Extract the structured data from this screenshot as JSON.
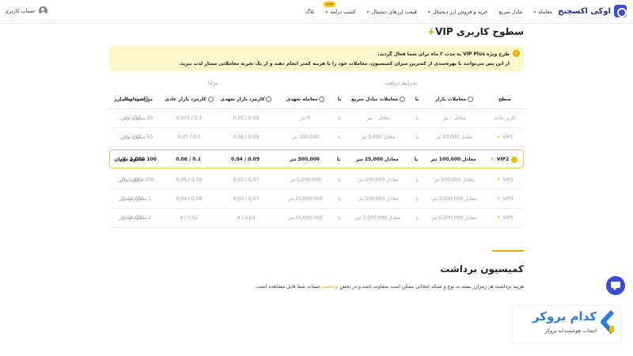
{
  "header": {
    "logo": "اوکی اکسچنج",
    "nav": [
      {
        "label": "معامله",
        "chevron": true,
        "badge": ""
      },
      {
        "label": "تبادل سریع",
        "chevron": false,
        "badge": ""
      },
      {
        "label": "خرید و فروش ارز دیجیتال",
        "chevron": true,
        "badge": ""
      },
      {
        "label": "قیمت ارزهای دیجیتال",
        "chevron": true,
        "badge": ""
      },
      {
        "label": "کسب درآمد",
        "chevron": true,
        "badge": "جدید"
      },
      {
        "label": "بلاگ",
        "chevron": false,
        "badge": ""
      }
    ],
    "account": "حساب کاربری"
  },
  "title": {
    "text": "سطوح کاربری VIP",
    "plus": "+"
  },
  "notice": {
    "line1_bold": "طرح ویژه VIP Plus به مدت ۳ ماه برای شما فعال گردید.",
    "line2": "از این پس می‌توانید با بهره‌مندی از کمترین میزان کمیسیون، معاملات خود را با هزینه کمتر انجام دهید و از یک تجربه معاملاتی ممتاز لذت ببرید."
  },
  "groups": {
    "conditions": "شرایط دریافت",
    "benefits": "مزایا"
  },
  "table": {
    "headers": [
      "سطح",
      "معاملات بازار",
      "یا",
      "معاملات تبادل سریع",
      "یا",
      "معامله تعهدی",
      "کارمزد بازار تعهدی",
      "کارمزد بازار عادی",
      "برداشت ریالی",
      "برداشت ارز"
    ],
    "rows": [
      [
        "کاربر عادی",
        "معادل ۰ تتر",
        "یا",
        "معادل ۰ تتر",
        "یا",
        "0 تتر",
        "0.09 / 0.05",
        "0.1 / 0.075",
        "20 میلیون تومان",
        "200 دلار"
      ],
      [
        "VIP1",
        "معادل 20,000 تتر",
        "یا",
        "معادل 5,000 تتر",
        "یا",
        "100,000 تتر",
        "0.09 / 0.04",
        "0.1 / 0.07",
        "50 میلیون تومان",
        "500 دلار"
      ],
      [
        "VIP2",
        "معادل 100,000 تتر",
        "یا",
        "معادل 25,000 تتر",
        "یا",
        "500,000 تتر",
        "0.09 / 0.04",
        "0.1 / 0.06",
        "100 میلیون تومان",
        "1,000 دلار"
      ],
      [
        "VIP3",
        "معادل 500,000 تتر",
        "یا",
        "معادل 100,000 تتر",
        "یا",
        "5,000,000 تتر",
        "0.07 / 0.03",
        "0.09 / 0.06",
        "200 میلیون تومان",
        "2,000 دلار"
      ],
      [
        "VIP4",
        "معادل 3,000,000 تتر",
        "یا",
        "معادل 500,000 تتر",
        "یا",
        "25,000,000 تتر",
        "0.07 / 0.03",
        "0.08 / 0.04",
        "1 میلیارد تومان",
        "10,000 دلار"
      ],
      [
        "VIP5",
        "معادل 5,000,000 تتر",
        "یا",
        "معادل 1,000,000 تتر",
        "یا",
        "35,000,000 تتر",
        "0.04 / 0",
        "0.02 / 0",
        "2 میلیارد تومان",
        "50,000 دلار"
      ]
    ],
    "active_row": 2
  },
  "commission": {
    "title": "کمیسیون برداشت",
    "text_before": "هزینه برداشت هر رمزارز بسته به نوع و شبکه انتخابی ممکن است متفاوت باشد و در بخش ",
    "link": "برداشت",
    "text_after": " حساب شما قابل مشاهده است."
  },
  "watermark": {
    "title": "کدام بروکر",
    "subtitle": "انتخاب هوشمندانه بروکر"
  },
  "colors": {
    "accent": "#e0a800",
    "brand": "#3b4bd8",
    "notice_bg": "#fff7cc"
  }
}
